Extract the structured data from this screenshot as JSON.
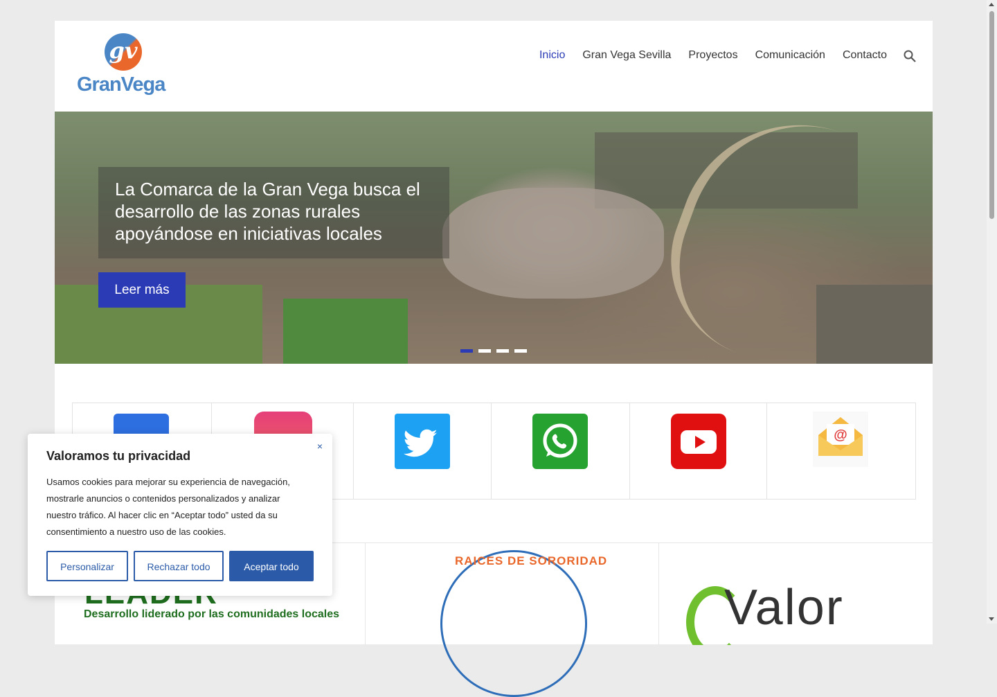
{
  "brand": {
    "name": "GranVega",
    "mark_letter": "gv"
  },
  "nav": {
    "items": [
      {
        "label": "Inicio",
        "active": true
      },
      {
        "label": "Gran Vega Sevilla",
        "active": false
      },
      {
        "label": "Proyectos",
        "active": false
      },
      {
        "label": "Comunicación",
        "active": false
      },
      {
        "label": "Contacto",
        "active": false
      }
    ],
    "search_icon": "search-icon"
  },
  "hero": {
    "caption": "La Comarca de la Gran Vega busca el desarrollo de las zonas rurales apoyándose en iniciativas locales",
    "button_label": "Leer más",
    "slide_count": 4,
    "active_slide": 1
  },
  "social": {
    "icons": [
      "facebook-icon",
      "instagram-icon",
      "twitter-icon",
      "whatsapp-icon",
      "youtube-icon",
      "email-icon"
    ]
  },
  "partners": {
    "leader_title": "LEADER",
    "leader_subtitle": "Desarrollo liderado por las comunidades locales",
    "raices_title": "RAICES DE SORORIDAD",
    "valor_title": "Valor"
  },
  "cookie": {
    "title": "Valoramos tu privacidad",
    "text": "Usamos cookies para mejorar su experiencia de navegación, mostrarle anuncios o contenidos personalizados y analizar nuestro tráfico. Al hacer clic en “Aceptar todo” usted da su consentimiento a nuestro uso de las cookies.",
    "close_label": "×",
    "buttons": {
      "customize": "Personalizar",
      "reject": "Rechazar todo",
      "accept": "Aceptar todo"
    }
  },
  "colors": {
    "accent": "#2b3bb5",
    "cookie_blue": "#2b5ba8",
    "logo_blue": "#4a86c5",
    "logo_orange": "#e9672a"
  }
}
